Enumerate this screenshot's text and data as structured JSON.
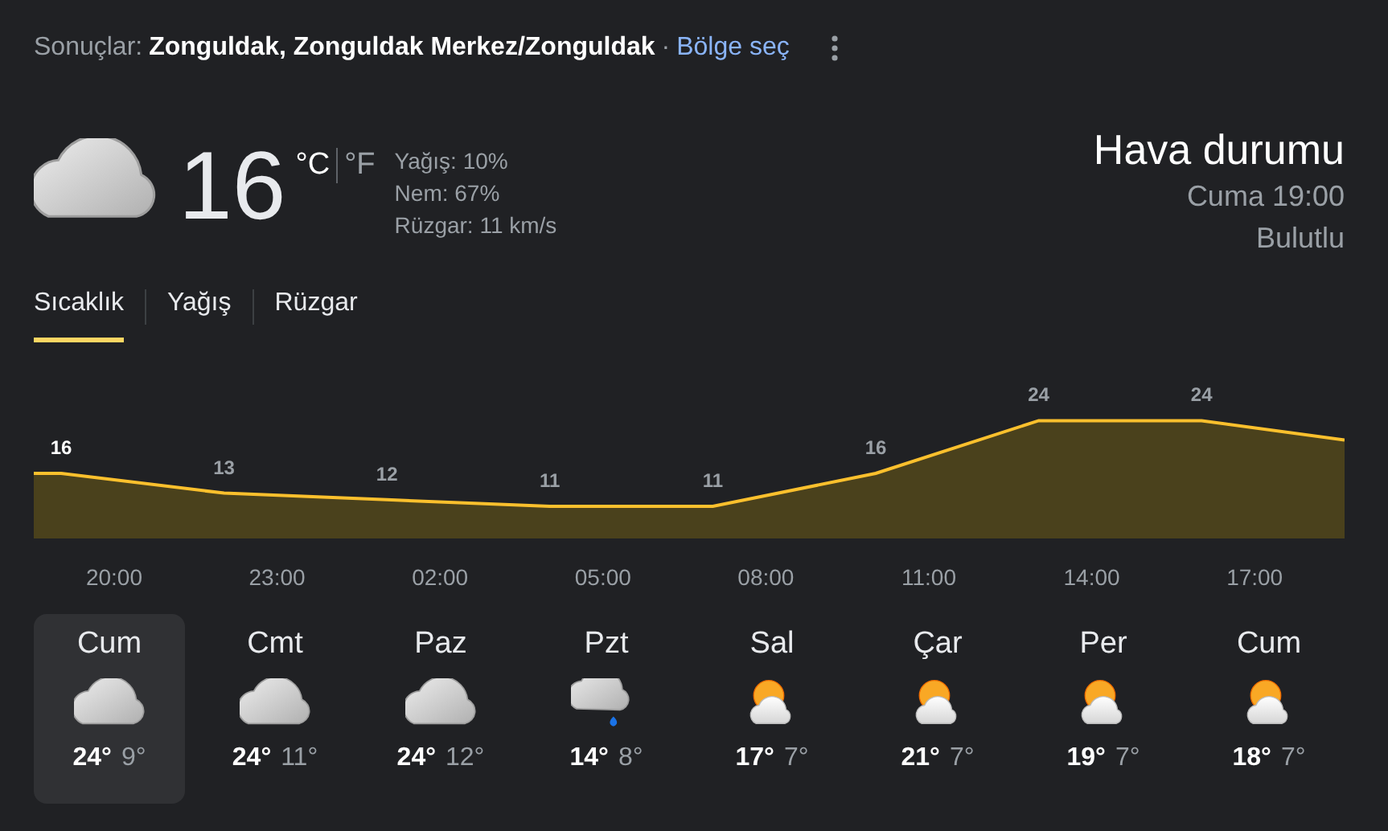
{
  "header": {
    "prefix": "Sonuçlar:",
    "location": "Zonguldak, Zonguldak Merkez/Zonguldak",
    "separator": "·",
    "link": "Bölge seç"
  },
  "current": {
    "kind": "cloudy",
    "temperature": "16",
    "units": [
      {
        "label": "°C",
        "selected": true
      },
      {
        "label": "°F",
        "selected": false
      }
    ],
    "details": [
      "Yağış: 10%",
      "Nem: 67%",
      "Rüzgar: 11 km/s"
    ],
    "title": "Hava durumu",
    "time": "Cuma 19:00",
    "condition": "Bulutlu"
  },
  "tabs": [
    {
      "label": "Sıcaklık",
      "selected": true
    },
    {
      "label": "Yağış",
      "selected": false
    },
    {
      "label": "Rüzgar",
      "selected": false
    }
  ],
  "hourly": [
    {
      "time": "20:00",
      "temperature": "16",
      "selected": true
    },
    {
      "time": "23:00",
      "temperature": "13",
      "selected": false
    },
    {
      "time": "02:00",
      "temperature": "12",
      "selected": false
    },
    {
      "time": "05:00",
      "temperature": "11",
      "selected": false
    },
    {
      "time": "08:00",
      "temperature": "11",
      "selected": false
    },
    {
      "time": "11:00",
      "temperature": "16",
      "selected": false
    },
    {
      "time": "14:00",
      "temperature": "24",
      "selected": false
    },
    {
      "time": "17:00",
      "temperature": "24",
      "selected": false
    }
  ],
  "days": [
    {
      "name": "Cum",
      "kind": "cloudy",
      "high": "24°",
      "low": "9°",
      "selected": true
    },
    {
      "name": "Cmt",
      "kind": "cloudy",
      "high": "24°",
      "low": "11°",
      "selected": false
    },
    {
      "name": "Paz",
      "kind": "cloudy",
      "high": "24°",
      "low": "12°",
      "selected": false
    },
    {
      "name": "Pzt",
      "kind": "rain",
      "high": "14°",
      "low": "8°",
      "selected": false
    },
    {
      "name": "Sal",
      "kind": "partly_sunny",
      "high": "17°",
      "low": "7°",
      "selected": false
    },
    {
      "name": "Çar",
      "kind": "partly_sunny",
      "high": "21°",
      "low": "7°",
      "selected": false
    },
    {
      "name": "Per",
      "kind": "partly_sunny",
      "high": "19°",
      "low": "7°",
      "selected": false
    },
    {
      "name": "Cum",
      "kind": "partly_sunny",
      "high": "18°",
      "low": "7°",
      "selected": false
    }
  ]
}
